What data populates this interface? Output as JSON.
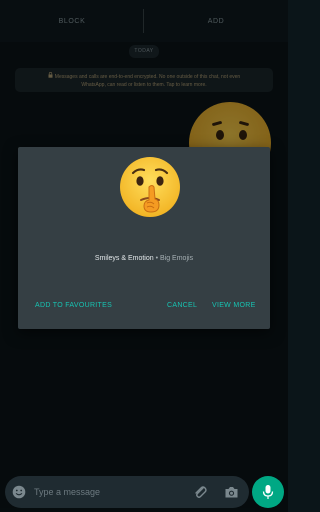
{
  "top_actions": {
    "block_label": "BLOCK",
    "add_label": "ADD"
  },
  "chat": {
    "date_chip": "TODAY",
    "encryption_notice": {
      "line1": "Messages and calls are end-to-end encrypted. No one outside of this chat, not even",
      "line2": "WhatsApp, can read or listen to them. Tap to learn more."
    }
  },
  "dialog": {
    "emoji_icon": "shushing-face-icon",
    "category": "Smileys & Emotion",
    "separator": " • ",
    "pack": "Big Emojis",
    "buttons": {
      "add_favourites": "ADD TO FAVOURITES",
      "cancel": "CANCEL",
      "view_more": "VIEW MORE"
    }
  },
  "composer": {
    "placeholder": "Type a message",
    "icons": [
      "emoji-icon",
      "attach-icon",
      "camera-icon",
      "mic-icon"
    ]
  },
  "colors": {
    "accent": "#17c3b2",
    "mic_button": "#00a884",
    "dialog_bg": "#353f44"
  }
}
